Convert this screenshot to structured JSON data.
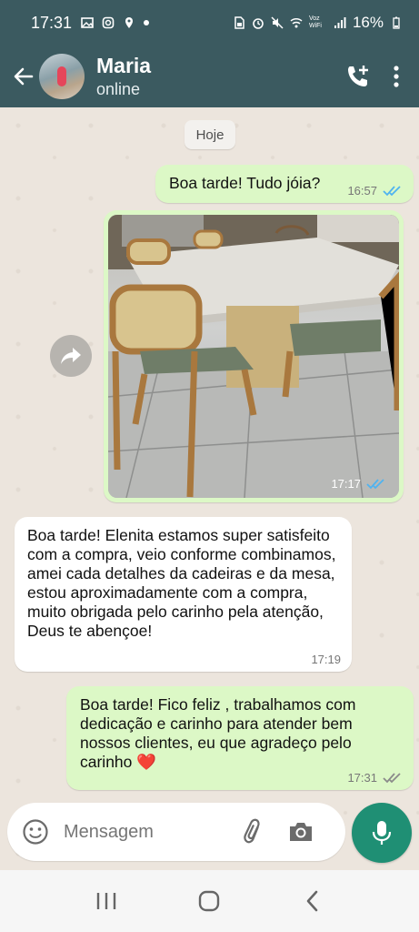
{
  "status_bar": {
    "time": "17:31",
    "battery": "16%",
    "network_label": "Voz WiFi",
    "icons": [
      "gallery-icon",
      "instagram-icon",
      "location-icon",
      "dot-icon",
      "sim-icon",
      "alarm-icon",
      "mute-icon",
      "wifi-icon",
      "signal-icon",
      "battery-icon"
    ]
  },
  "header": {
    "contact_name": "Maria",
    "contact_status": "online",
    "actions": [
      "add-call-icon",
      "more-options-icon"
    ]
  },
  "chat": {
    "date_chip": "Hoje",
    "messages": [
      {
        "direction": "outgoing",
        "text": "Boa tarde! Tudo jóia?",
        "time": "16:57",
        "status": "read"
      },
      {
        "direction": "outgoing",
        "type": "image",
        "time": "17:17",
        "status": "read"
      },
      {
        "direction": "incoming",
        "text": "Boa tarde! Elenita estamos super satisfeito com a compra, veio conforme combinamos, amei cada detalhes da cadeiras e da mesa, estou aproximadamente com a compra, muito obrigada pelo carinho pela atenção, Deus te abençoe!",
        "time": "17:19"
      },
      {
        "direction": "outgoing",
        "text": "Boa tarde! Fico feliz , trabalhamos com dedicação e carinho para atender bem nossos clientes,  eu que agradeço pelo carinho",
        "emoji": "❤️",
        "time": "17:31",
        "status": "delivered"
      }
    ]
  },
  "composer": {
    "placeholder": "Mensagem"
  },
  "colors": {
    "header": "#3b5a60",
    "outgoing_bubble": "#dcf8c6",
    "incoming_bubble": "#ffffff",
    "read_tick": "#4fb3f0",
    "mic_button": "#1f8f74"
  }
}
